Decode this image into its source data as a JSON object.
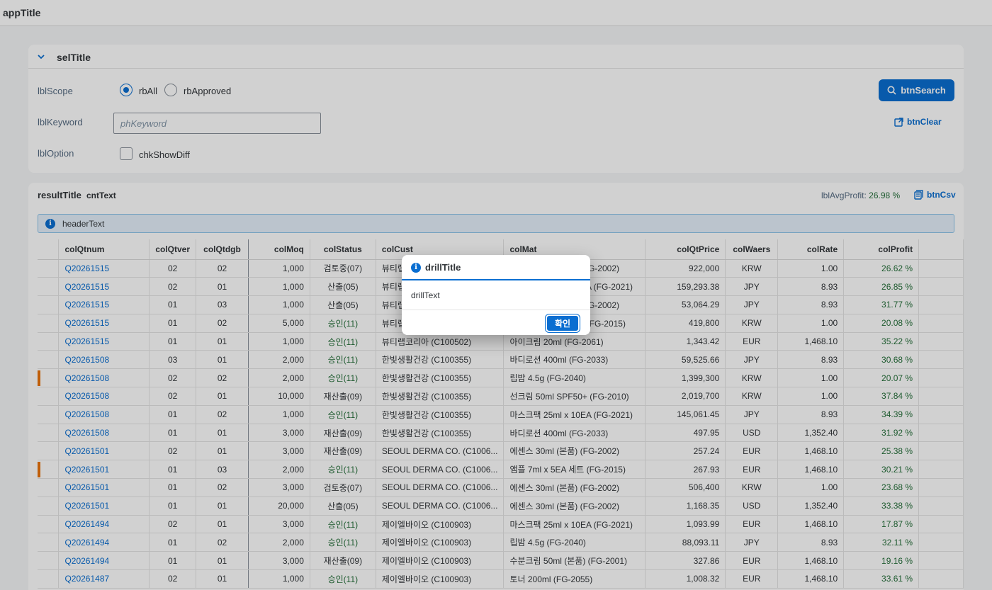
{
  "shell": {
    "title": "appTitle"
  },
  "selection": {
    "title": "selTitle",
    "scope_label": "lblScope",
    "radio_all": "rbAll",
    "radio_approved": "rbApproved",
    "keyword_label": "lblKeyword",
    "keyword_placeholder": "phKeyword",
    "keyword_value": "",
    "option_label": "lblOption",
    "checkbox_label": "chkShowDiff",
    "search_button": "btnSearch",
    "clear_button": "btnClear"
  },
  "result": {
    "title": "resultTitle",
    "count_text": "cntText",
    "avg_profit_label": "lblAvgProfit:",
    "avg_profit_value": "26.98 %",
    "csv_button": "btnCsv",
    "header_text": "headerText",
    "columns": [
      "",
      "colQtnum",
      "colQtver",
      "colQtdgb",
      "colMoq",
      "colStatus",
      "colCust",
      "colMat",
      "colQtPrice",
      "colWaers",
      "colRate",
      "colProfit",
      ""
    ],
    "rows": [
      {
        "mark": false,
        "qtnum": "Q20261515",
        "qtver": "02",
        "qtdgb": "02",
        "moq": "1,000",
        "status": "검토중(07)",
        "status_ok": false,
        "cust": "뷰티랩코리아 (C100502)",
        "mat": "에센스 30ml (본품) (FG-2002)",
        "price": "922,000",
        "waers": "KRW",
        "rate": "1.00",
        "profit": "26.62 %"
      },
      {
        "mark": false,
        "qtnum": "Q20261515",
        "qtver": "02",
        "qtdgb": "01",
        "moq": "1,000",
        "status": "산출(05)",
        "status_ok": false,
        "cust": "뷰티랩코리아 (C100502)",
        "mat": "마스크팩 25ml x 10EA (FG-2021)",
        "price": "159,293.38",
        "waers": "JPY",
        "rate": "8.93",
        "profit": "26.85 %"
      },
      {
        "mark": false,
        "qtnum": "Q20261515",
        "qtver": "01",
        "qtdgb": "03",
        "moq": "1,000",
        "status": "산출(05)",
        "status_ok": false,
        "cust": "뷰티랩코리아 (C100502)",
        "mat": "에센스 30ml (본품) (FG-2002)",
        "price": "53,064.29",
        "waers": "JPY",
        "rate": "8.93",
        "profit": "31.77 %"
      },
      {
        "mark": false,
        "qtnum": "Q20261515",
        "qtver": "01",
        "qtdgb": "02",
        "moq": "5,000",
        "status": "승인(11)",
        "status_ok": true,
        "cust": "뷰티랩코리아 (C100502)",
        "mat": "앰플 7ml x 5EA 세트 (FG-2015)",
        "price": "419,800",
        "waers": "KRW",
        "rate": "1.00",
        "profit": "20.08 %"
      },
      {
        "mark": false,
        "qtnum": "Q20261515",
        "qtver": "01",
        "qtdgb": "01",
        "moq": "1,000",
        "status": "승인(11)",
        "status_ok": true,
        "cust": "뷰티랩코리아 (C100502)",
        "mat": "아이크림 20ml (FG-2061)",
        "price": "1,343.42",
        "waers": "EUR",
        "rate": "1,468.10",
        "profit": "35.22 %"
      },
      {
        "mark": false,
        "qtnum": "Q20261508",
        "qtver": "03",
        "qtdgb": "01",
        "moq": "2,000",
        "status": "승인(11)",
        "status_ok": true,
        "cust": "한빛생활건강 (C100355)",
        "mat": "바디로션 400ml (FG-2033)",
        "price": "59,525.66",
        "waers": "JPY",
        "rate": "8.93",
        "profit": "30.68 %"
      },
      {
        "mark": true,
        "qtnum": "Q20261508",
        "qtver": "02",
        "qtdgb": "02",
        "moq": "2,000",
        "status": "승인(11)",
        "status_ok": true,
        "cust": "한빛생활건강 (C100355)",
        "mat": "립밤 4.5g (FG-2040)",
        "price": "1,399,300",
        "waers": "KRW",
        "rate": "1.00",
        "profit": "20.07 %"
      },
      {
        "mark": false,
        "qtnum": "Q20261508",
        "qtver": "02",
        "qtdgb": "01",
        "moq": "10,000",
        "status": "재산출(09)",
        "status_ok": false,
        "cust": "한빛생활건강 (C100355)",
        "mat": "선크림 50ml SPF50+ (FG-2010)",
        "price": "2,019,700",
        "waers": "KRW",
        "rate": "1.00",
        "profit": "37.84 %"
      },
      {
        "mark": false,
        "qtnum": "Q20261508",
        "qtver": "01",
        "qtdgb": "02",
        "moq": "1,000",
        "status": "승인(11)",
        "status_ok": true,
        "cust": "한빛생활건강 (C100355)",
        "mat": "마스크팩 25ml x 10EA (FG-2021)",
        "price": "145,061.45",
        "waers": "JPY",
        "rate": "8.93",
        "profit": "34.39 %"
      },
      {
        "mark": false,
        "qtnum": "Q20261508",
        "qtver": "01",
        "qtdgb": "01",
        "moq": "3,000",
        "status": "재산출(09)",
        "status_ok": false,
        "cust": "한빛생활건강 (C100355)",
        "mat": "바디로션 400ml (FG-2033)",
        "price": "497.95",
        "waers": "USD",
        "rate": "1,352.40",
        "profit": "31.92 %"
      },
      {
        "mark": false,
        "qtnum": "Q20261501",
        "qtver": "02",
        "qtdgb": "01",
        "moq": "3,000",
        "status": "재산출(09)",
        "status_ok": false,
        "cust": "SEOUL DERMA CO. (C1006...",
        "mat": "에센스 30ml (본품) (FG-2002)",
        "price": "257.24",
        "waers": "EUR",
        "rate": "1,468.10",
        "profit": "25.38 %"
      },
      {
        "mark": true,
        "qtnum": "Q20261501",
        "qtver": "01",
        "qtdgb": "03",
        "moq": "2,000",
        "status": "승인(11)",
        "status_ok": true,
        "cust": "SEOUL DERMA CO. (C1006...",
        "mat": "앰플 7ml x 5EA 세트 (FG-2015)",
        "price": "267.93",
        "waers": "EUR",
        "rate": "1,468.10",
        "profit": "30.21 %"
      },
      {
        "mark": false,
        "qtnum": "Q20261501",
        "qtver": "01",
        "qtdgb": "02",
        "moq": "3,000",
        "status": "검토중(07)",
        "status_ok": false,
        "cust": "SEOUL DERMA CO. (C1006...",
        "mat": "에센스 30ml (본품) (FG-2002)",
        "price": "506,400",
        "waers": "KRW",
        "rate": "1.00",
        "profit": "23.68 %"
      },
      {
        "mark": false,
        "qtnum": "Q20261501",
        "qtver": "01",
        "qtdgb": "01",
        "moq": "20,000",
        "status": "산출(05)",
        "status_ok": false,
        "cust": "SEOUL DERMA CO. (C1006...",
        "mat": "에센스 30ml (본품) (FG-2002)",
        "price": "1,168.35",
        "waers": "USD",
        "rate": "1,352.40",
        "profit": "33.38 %"
      },
      {
        "mark": false,
        "qtnum": "Q20261494",
        "qtver": "02",
        "qtdgb": "01",
        "moq": "3,000",
        "status": "승인(11)",
        "status_ok": true,
        "cust": "제이엘바이오 (C100903)",
        "mat": "마스크팩 25ml x 10EA (FG-2021)",
        "price": "1,093.99",
        "waers": "EUR",
        "rate": "1,468.10",
        "profit": "17.87 %"
      },
      {
        "mark": false,
        "qtnum": "Q20261494",
        "qtver": "01",
        "qtdgb": "02",
        "moq": "2,000",
        "status": "승인(11)",
        "status_ok": true,
        "cust": "제이엘바이오 (C100903)",
        "mat": "립밤 4.5g (FG-2040)",
        "price": "88,093.11",
        "waers": "JPY",
        "rate": "8.93",
        "profit": "32.11 %"
      },
      {
        "mark": false,
        "qtnum": "Q20261494",
        "qtver": "01",
        "qtdgb": "01",
        "moq": "3,000",
        "status": "재산출(09)",
        "status_ok": false,
        "cust": "제이엘바이오 (C100903)",
        "mat": "수분크림 50ml (본품) (FG-2001)",
        "price": "327.86",
        "waers": "EUR",
        "rate": "1,468.10",
        "profit": "19.16 %"
      },
      {
        "mark": false,
        "qtnum": "Q20261487",
        "qtver": "02",
        "qtdgb": "01",
        "moq": "1,000",
        "status": "승인(11)",
        "status_ok": true,
        "cust": "제이엘바이오 (C100903)",
        "mat": "토너 200ml (FG-2055)",
        "price": "1,008.32",
        "waers": "EUR",
        "rate": "1,468.10",
        "profit": "33.61 %"
      }
    ]
  },
  "dialog": {
    "title": "drillTitle",
    "text": "drillText",
    "ok_button": "확인"
  },
  "colors": {
    "accent": "#0a6ed1",
    "positive": "#256f3a",
    "marker": "#e9730c"
  }
}
